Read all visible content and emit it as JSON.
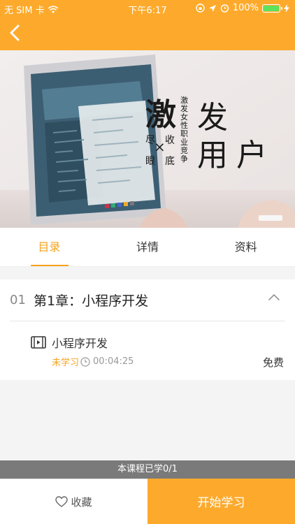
{
  "status_bar": {
    "carrier": "无 SIM 卡",
    "time": "下午6:17",
    "battery_percent": "100%",
    "battery_level": 1.0
  },
  "nav": {
    "back_icon": "chevron-left-icon"
  },
  "hero": {
    "title_line1_char1": "激",
    "title_line1_char2": "发",
    "title_line2_char1": "用",
    "title_line2_char2": "户",
    "small_left_top": "尽",
    "small_left_bottom": "眼",
    "small_right_top": "收",
    "small_right_bottom": "底",
    "cross": "×",
    "vertical_text": "激发女性职业竞争"
  },
  "tabs": [
    {
      "label": "目录",
      "active": true
    },
    {
      "label": "详情",
      "active": false
    },
    {
      "label": "资料",
      "active": false
    }
  ],
  "chapter": {
    "number": "01",
    "title": "第1章：小程序开发",
    "lesson": {
      "title": "小程序开发",
      "status": "未学习",
      "duration": "00:04:25",
      "price": "免费"
    }
  },
  "progress_text": "本课程已学0/1",
  "bottom": {
    "favorite_label": "收藏",
    "start_label": "开始学习"
  },
  "colors": {
    "accent": "#fdaa2c",
    "active_tab": "#f6a31d"
  }
}
